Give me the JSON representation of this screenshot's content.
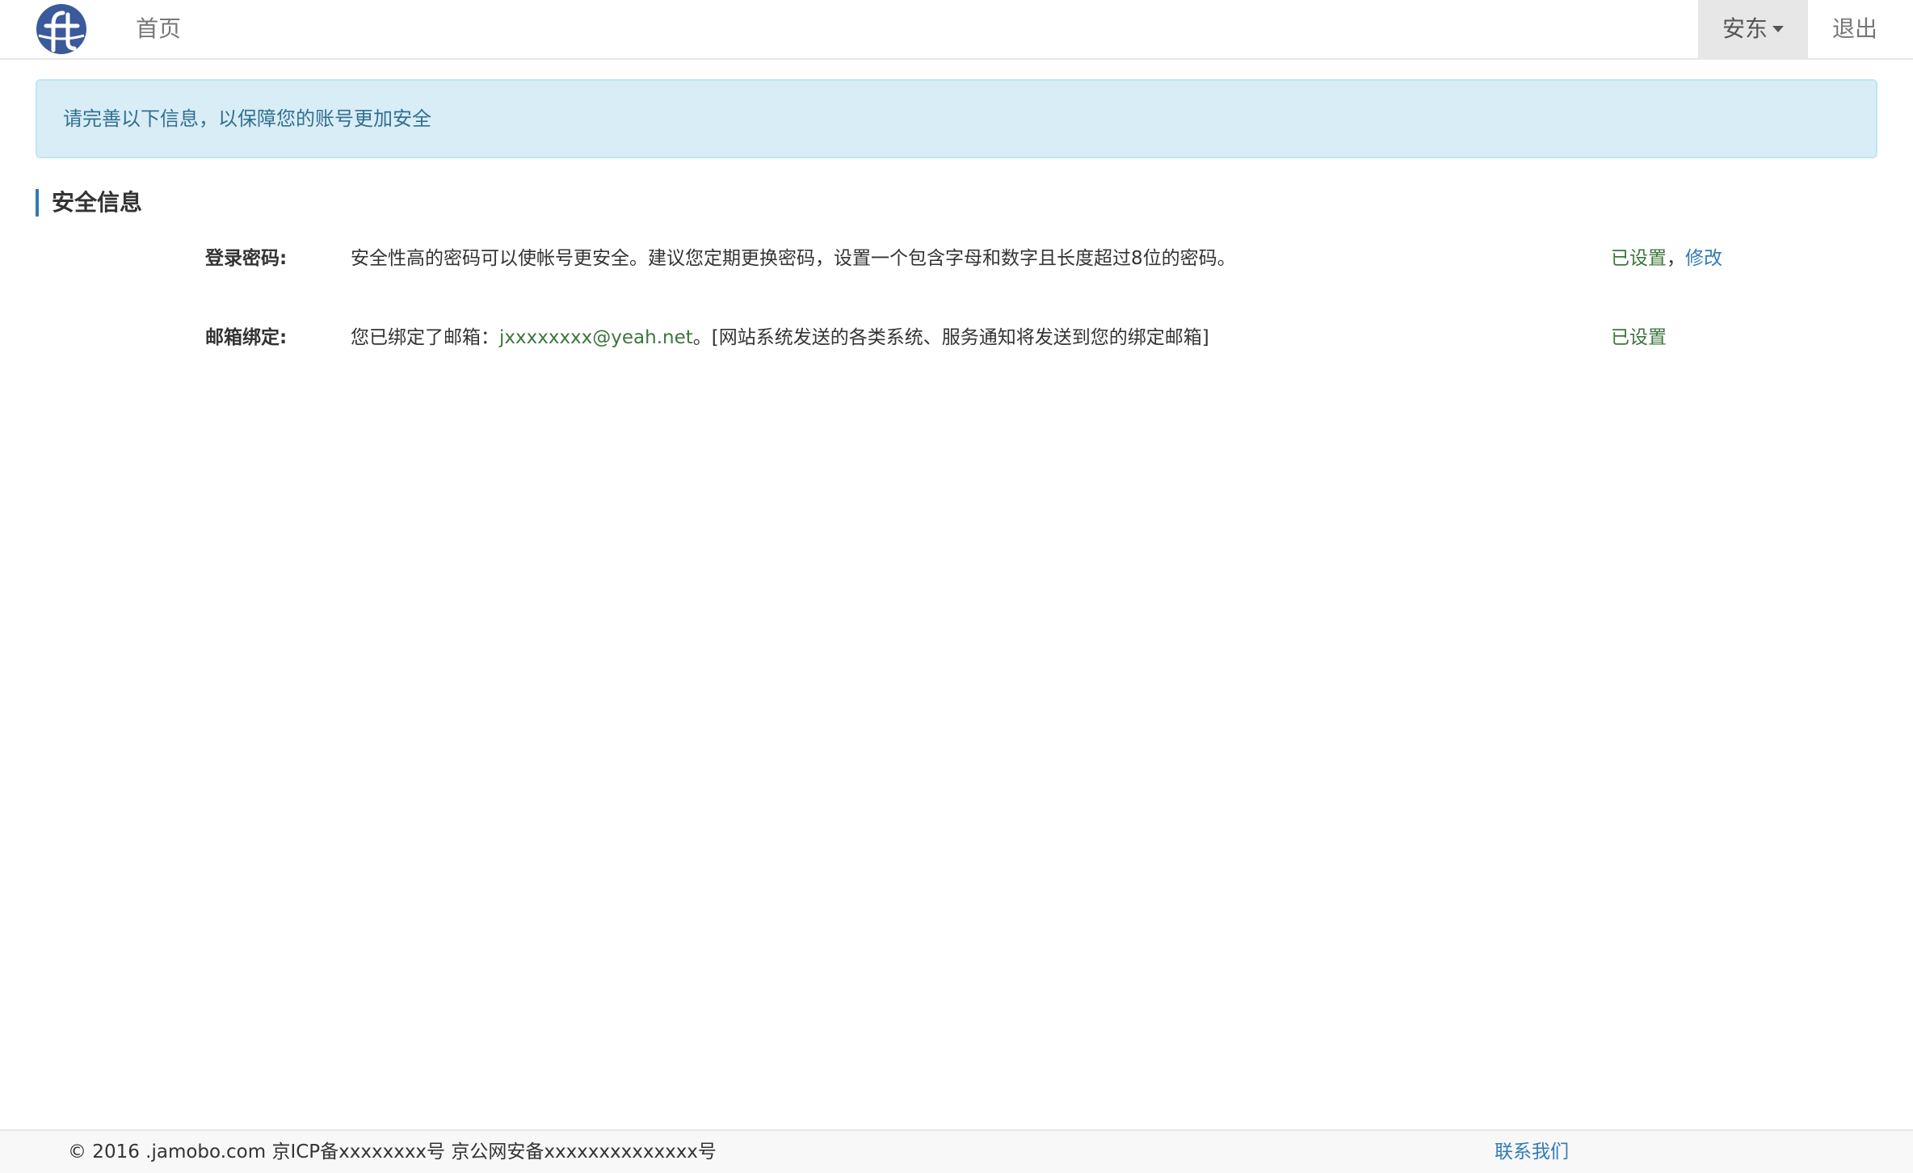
{
  "colors": {
    "brand_logo": "#3a5a9c",
    "alert_bg": "#d9edf7",
    "alert_text": "#31708f",
    "accent_bar": "#337ab7",
    "status_green": "#3c763d",
    "link_blue": "#337ab7"
  },
  "navbar": {
    "logo_icon": "ft-logo-icon",
    "home_label": "首页",
    "user_name": "安东",
    "user_dropdown_icon": "caret-down-icon",
    "logout_label": "退出"
  },
  "alert": {
    "message": "请完善以下信息，以保障您的账号更加安全"
  },
  "section": {
    "title": "安全信息"
  },
  "rows": [
    {
      "label": "登录密码:",
      "description": "安全性高的密码可以使帐号更安全。建议您定期更换密码，设置一个包含字母和数字且长度超过8位的密码。",
      "status": "已设置",
      "separator": "，",
      "action_label": "修改"
    },
    {
      "label": "邮箱绑定:",
      "description_prefix": "您已绑定了邮箱：",
      "email": "jxxxxxxxx@yeah.net",
      "description_suffix": "。[网站系统发送的各类系统、服务通知将发送到您的绑定邮箱]",
      "status": "已设置"
    }
  ],
  "footer": {
    "copyright": "© 2016 .jamobo.com 京ICP备xxxxxxxx号 京公网安备xxxxxxxxxxxxxx号",
    "contact_label": "联系我们"
  }
}
